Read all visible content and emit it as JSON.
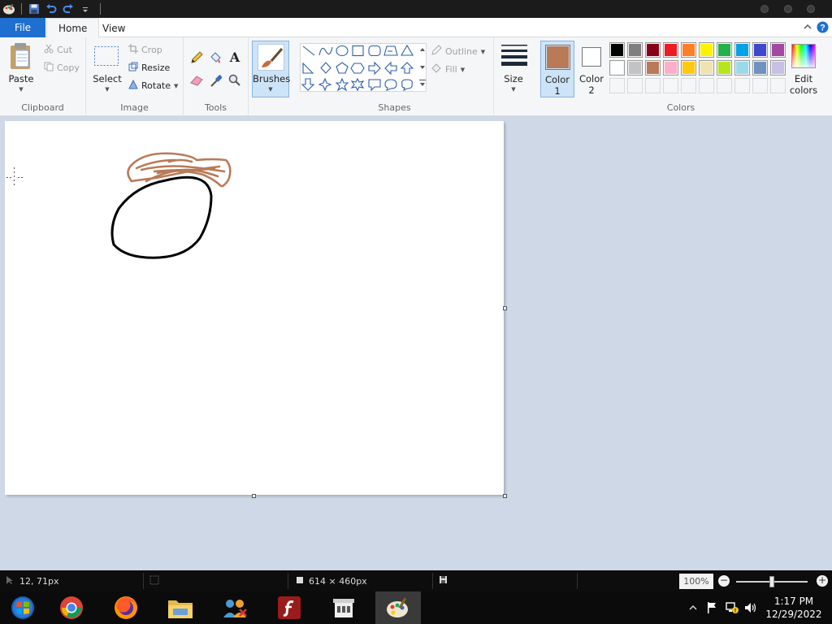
{
  "ribbon_tabs": {
    "file": "File",
    "home": "Home",
    "view": "View"
  },
  "clipboard": {
    "paste": "Paste",
    "cut": "Cut",
    "copy": "Copy",
    "label": "Clipboard"
  },
  "image": {
    "select": "Select",
    "crop": "Crop",
    "resize": "Resize",
    "rotate": "Rotate",
    "label": "Image"
  },
  "tools": {
    "label": "Tools",
    "items": [
      "pencil-icon",
      "fill-icon",
      "text-icon",
      "eraser-icon",
      "color-picker-icon",
      "magnifier-icon"
    ]
  },
  "brushes": {
    "label": "Brushes"
  },
  "shapes": {
    "outline": "Outline",
    "fill": "Fill",
    "label": "Shapes"
  },
  "size": {
    "label": "Size"
  },
  "colors": {
    "color1_label": "Color",
    "color1_num": "1",
    "color2_label": "Color",
    "color2_num": "2",
    "edit_label": "Edit",
    "edit_label2": "colors",
    "label": "Colors",
    "color1_value": "#b97a57",
    "color2_value": "#ffffff",
    "palette_row1": [
      "#000000",
      "#7f7f7f",
      "#880015",
      "#ed1c24",
      "#ff7f27",
      "#fff200",
      "#22b14c",
      "#00a2e8",
      "#3f48cc",
      "#a349a4"
    ],
    "palette_row2": [
      "#ffffff",
      "#c3c3c3",
      "#b97a57",
      "#ffaec9",
      "#ffc90e",
      "#efe4b0",
      "#b5e61d",
      "#99d9ea",
      "#7092be",
      "#c8bfe7"
    ]
  },
  "status": {
    "cursor_pos": "12, 71px",
    "canvas_size": "614 × 460px",
    "zoom": "100%",
    "zoom_level": 0.5
  },
  "clock": {
    "time": "1:17 PM",
    "date": "12/29/2022"
  }
}
